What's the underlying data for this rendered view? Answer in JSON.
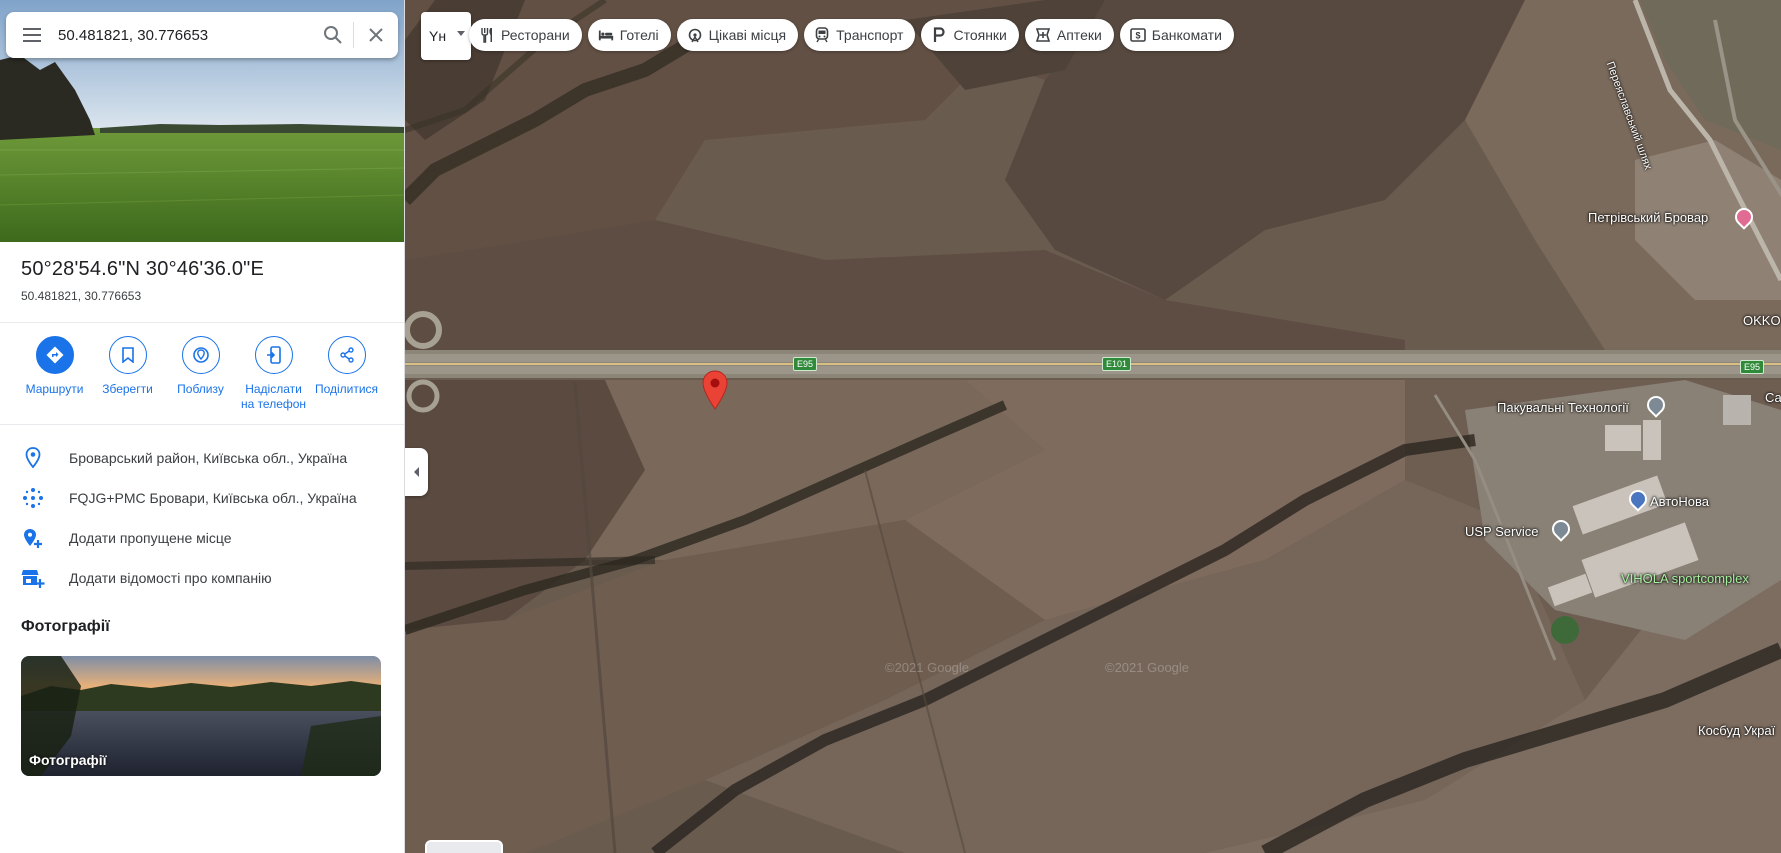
{
  "search": {
    "value": "50.481821, 30.776653",
    "menu_icon": "menu-icon",
    "search_icon": "search-icon",
    "close_icon": "close-icon"
  },
  "place": {
    "title": "50°28'54.6\"N 30°46'36.0\"E",
    "subtitle": "50.481821, 30.776653"
  },
  "actions": [
    {
      "label": "Маршрути",
      "icon": "directions-icon"
    },
    {
      "label": "Зберегти",
      "icon": "bookmark-icon"
    },
    {
      "label": "Поблизу",
      "icon": "nearby-icon"
    },
    {
      "label": "Надіслати на телефон",
      "icon": "send-to-phone-icon"
    },
    {
      "label": "Поділитися",
      "icon": "share-icon"
    }
  ],
  "info": [
    {
      "text": "Броварський район, Київська обл., Україна",
      "icon": "location-pin-icon"
    },
    {
      "text": "FQJG+PMC Бровари, Київська обл., Україна",
      "icon": "plus-code-icon"
    },
    {
      "text": "Додати пропущене місце",
      "icon": "add-place-icon"
    },
    {
      "text": "Додати відомості про компанію",
      "icon": "add-business-icon"
    }
  ],
  "photos": {
    "heading": "Фотографії",
    "card_label": "Фотографії"
  },
  "map": {
    "language_button": "Yн",
    "chips": [
      {
        "label": "Ресторани",
        "icon": "restaurant-icon"
      },
      {
        "label": "Готелі",
        "icon": "hotel-icon"
      },
      {
        "label": "Цікаві місця",
        "icon": "attractions-icon"
      },
      {
        "label": "Транспорт",
        "icon": "transit-icon"
      },
      {
        "label": "Стоянки",
        "icon": "parking-icon"
      },
      {
        "label": "Аптеки",
        "icon": "pharmacy-icon"
      },
      {
        "label": "Банкомати",
        "icon": "atm-icon"
      }
    ],
    "labels": {
      "road_name": "Переяславський шлях",
      "petrivsky": "Петрівський Бровар",
      "okko": "OKKO",
      "sa": "Са",
      "pakuvalni": "Пакувальні Технології",
      "avtonova": "АвтоНова",
      "usp": "USP Service",
      "vihola": "VIHOLA sportcomplex",
      "kosbud": "Косбуд Украї"
    },
    "shields": {
      "e95_left": "E95",
      "e101": "E101",
      "e95_right": "E95"
    },
    "watermark": "©2021 Google"
  },
  "colors": {
    "accent": "#1a73e8",
    "marker": "#ea4335",
    "field": "#6b5c50"
  }
}
